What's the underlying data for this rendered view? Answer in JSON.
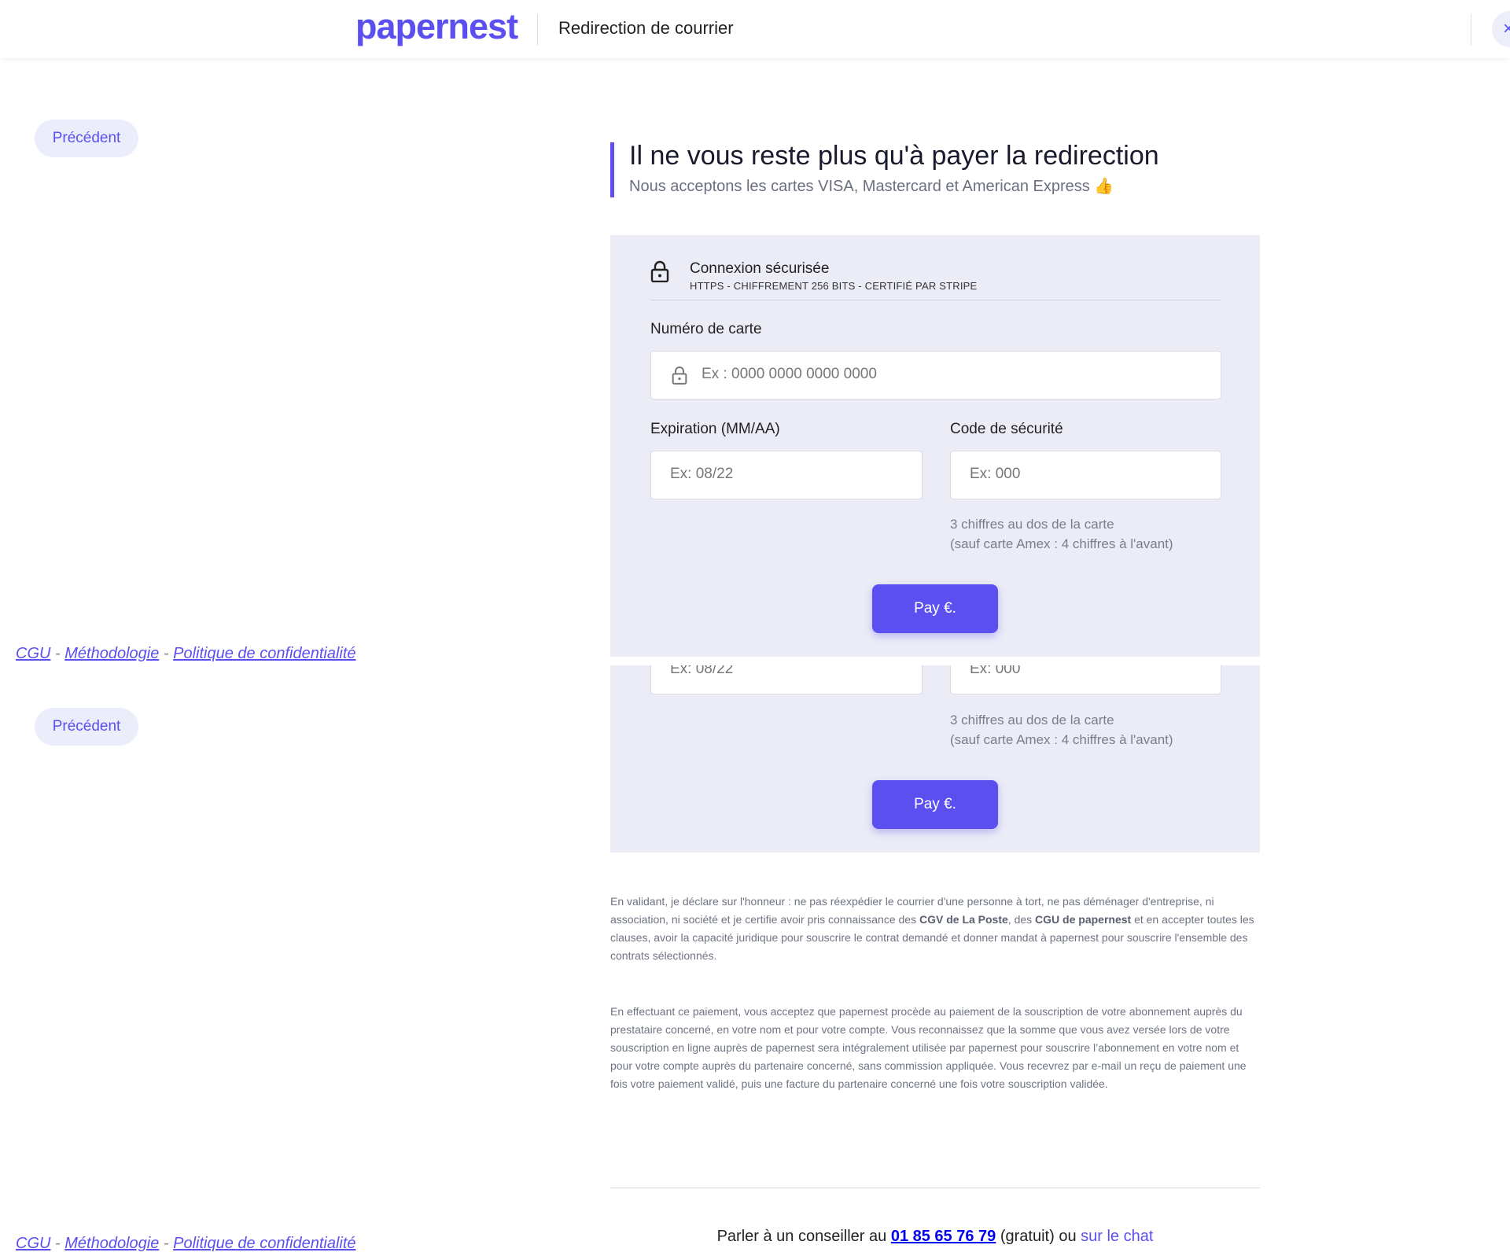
{
  "header": {
    "logo": "papernest",
    "title": "Redirection de courrier",
    "close_icon": "×"
  },
  "nav": {
    "prev_label": "Précédent"
  },
  "footer_links": {
    "cgu": "CGU",
    "sep": "-",
    "methodologie": "Méthodologie",
    "politique": "Politique de confidentialité"
  },
  "page": {
    "title": "Il ne vous reste plus qu'à payer la redirection",
    "subtitle": "Nous acceptons les cartes VISA, Mastercard et American Express 👍"
  },
  "payment": {
    "secure_title": "Connexion sécurisée",
    "secure_sub": "HTTPS - CHIFFREMENT 256 BITS - CERTIFIÉ PAR STRIPE",
    "card_number_label": "Numéro de carte",
    "card_number_placeholder": "Ex : 0000 0000 0000 0000",
    "expiration_label": "Expiration (MM/AA)",
    "expiration_placeholder": "Ex: 08/22",
    "cvc_label": "Code de sécurité",
    "cvc_placeholder": "Ex: 000",
    "cvc_hint_1": "3 chiffres au dos de la carte",
    "cvc_hint_2": "(sauf carte Amex : 4 chiffres à l'avant)",
    "pay_label": "Pay €."
  },
  "legal": {
    "p1_a": "En validant, je déclare sur l'honneur : ne pas réexpédier le courrier d'une personne à tort, ne pas déménager d'entreprise, ni association, ni société et je certifie avoir pris connaissance des ",
    "p1_b": "CGV de La Poste",
    "p1_c": ", des ",
    "p1_d": "CGU de papernest",
    "p1_e": " et en accepter toutes les clauses, avoir la capacité juridique pour souscrire le contrat demandé et donner mandat à papernest pour souscrire l'ensemble des contrats sélectionnés.",
    "p2": "En effectuant ce paiement, vous acceptez que papernest procède au paiement de la souscription de votre abonnement auprès du prestataire concerné, en votre nom et pour votre compte. Vous reconnaissez que la somme que vous avez versée lors de votre souscription en ligne auprès de papernest sera intégralement utilisée par papernest pour souscrire l’abonnement en votre nom et pour votre compte auprès du partenaire concerné, sans commission appliquée. Vous recevrez par e-mail un reçu de paiement une fois votre paiement validé, puis une facture du partenaire concerné une fois votre souscription validée."
  },
  "advisor": {
    "prefix": "Parler à un conseiller au ",
    "phone": "01 85 65 76 79",
    "middle": " (gratuit) ou ",
    "chat": "sur le chat"
  }
}
